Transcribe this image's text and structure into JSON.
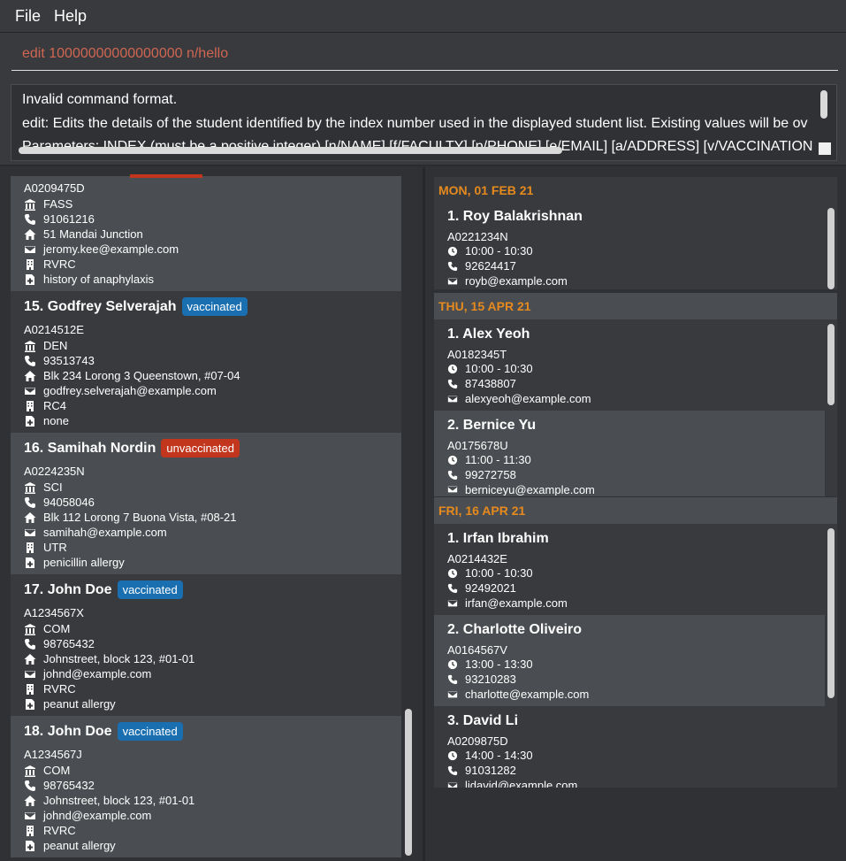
{
  "menu": {
    "file": "File",
    "help": "Help"
  },
  "command": {
    "value": "edit 10000000000000000 n/hello"
  },
  "result": {
    "line1": "Invalid command format.",
    "line2": "edit: Edits the details of the student identified by the index number used in the displayed student list. Existing values will be ov",
    "line3": "Parameters: INDEX (must be a positive integer) [n/NAME] [f/FACULTY] [p/PHONE] [e/EMAIL] [a/ADDRESS] [v/VACCINATION"
  },
  "students": {
    "s14": {
      "id": "A0209475D",
      "faculty": "FASS",
      "phone": "91061216",
      "address": "51 Mandai Junction",
      "email": "jeromy.kee@example.com",
      "residence": "RVRC",
      "medical": "history of anaphylaxis"
    },
    "s15": {
      "name": "15.  Godfrey Selverajah",
      "badge": "vaccinated",
      "id": "A0214512E",
      "faculty": "DEN",
      "phone": "93513743",
      "address": "Blk 234 Lorong 3 Queenstown, #07-04",
      "email": "godfrey.selverajah@example.com",
      "residence": "RC4",
      "medical": "none"
    },
    "s16": {
      "name": "16.  Samihah Nordin",
      "badge": "unvaccinated",
      "id": "A0224235N",
      "faculty": "SCI",
      "phone": "94058046",
      "address": "Blk 112 Lorong 7 Buona Vista, #08-21",
      "email": "samihah@example.com",
      "residence": "UTR",
      "medical": "penicillin allergy"
    },
    "s17": {
      "name": "17.  John Doe",
      "badge": "vaccinated",
      "id": "A1234567X",
      "faculty": "COM",
      "phone": "98765432",
      "address": "Johnstreet, block 123, #01-01",
      "email": "johnd@example.com",
      "residence": "RVRC",
      "medical": "peanut allergy"
    },
    "s18": {
      "name": "18.  John Doe",
      "badge": "vaccinated",
      "id": "A1234567J",
      "faculty": "COM",
      "phone": "98765432",
      "address": "Johnstreet, block 123, #01-01",
      "email": "johnd@example.com",
      "residence": "RVRC",
      "medical": "peanut allergy"
    }
  },
  "appointments": {
    "d1": {
      "date": "MON, 01 FEB 21",
      "a1": {
        "name": "1.  Roy Balakrishnan",
        "id": "A0221234N",
        "time": "10:00 - 10:30",
        "phone": "92624417",
        "email": "royb@example.com"
      }
    },
    "d2": {
      "date": "THU, 15 APR 21",
      "a1": {
        "name": "1.  Alex Yeoh",
        "id": "A0182345T",
        "time": "10:00 - 10:30",
        "phone": "87438807",
        "email": "alexyeoh@example.com"
      },
      "a2": {
        "name": "2.  Bernice Yu",
        "id": "A0175678U",
        "time": "11:00 - 11:30",
        "phone": "99272758",
        "email": "berniceyu@example.com"
      }
    },
    "d3": {
      "date": "FRI, 16 APR 21",
      "a1": {
        "name": "1.  Irfan Ibrahim",
        "id": "A0214432E",
        "time": "10:00 - 10:30",
        "phone": "92492021",
        "email": "irfan@example.com"
      },
      "a2": {
        "name": "2.  Charlotte Oliveiro",
        "id": "A0164567V",
        "time": "13:00 - 13:30",
        "phone": "93210283",
        "email": "charlotte@example.com"
      },
      "a3": {
        "name": "3.  David Li",
        "id": "A0209875D",
        "time": "14:00 - 14:30",
        "phone": "91031282",
        "email": "lidavid@example.com"
      }
    }
  },
  "colors": {
    "accent": "#e68a1e",
    "vaccinated": "#1a6fb0",
    "unvaccinated": "#c2361e",
    "error_text": "#d06651"
  }
}
